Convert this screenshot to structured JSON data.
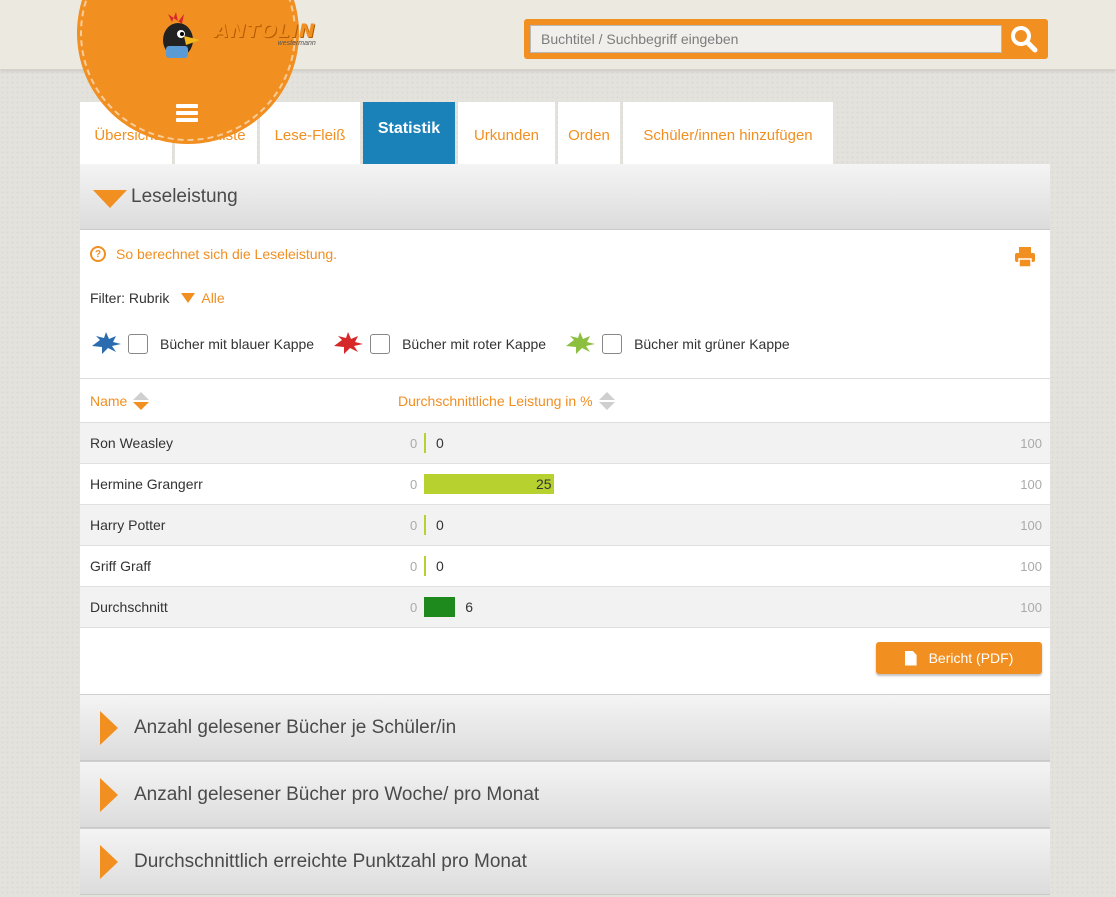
{
  "brand": {
    "name": "ANTOLIN",
    "sub": "westermann"
  },
  "search": {
    "placeholder": "Buchtitel / Suchbegriff eingeben"
  },
  "tabs": [
    {
      "label": "Übersicht",
      "active": false
    },
    {
      "label": "Leseliste",
      "active": false
    },
    {
      "label": "Lese-Fleiß",
      "active": false
    },
    {
      "label": "Statistik",
      "active": true
    },
    {
      "label": "Urkunden",
      "active": false
    },
    {
      "label": "Orden",
      "active": false
    },
    {
      "label": "Schüler/innen hinzufügen",
      "active": false
    }
  ],
  "lead": {
    "title": "Leseleistung",
    "help": "So berechnet sich die Leseleistung.",
    "filter_label": "Filter: Rubrik",
    "filter_value": "Alle",
    "caps": [
      {
        "label": "Bücher mit blauer Kappe",
        "color": "#2b6cb0",
        "icon": "blue-cap-icon"
      },
      {
        "label": "Bücher mit roter Kappe",
        "color": "#d62828",
        "icon": "red-cap-icon"
      },
      {
        "label": "Bücher mit grüner Kappe",
        "color": "#8cbf3f",
        "icon": "green-cap-icon"
      }
    ],
    "col_name": "Name",
    "col_perf": "Durchschnittliche Leistung in %",
    "min_label": "0",
    "max_label": "100",
    "rows": [
      {
        "name": "Ron Weasley",
        "value": 0,
        "label": "0",
        "color": "#b7d12f"
      },
      {
        "name": "Hermine Grangerr",
        "value": 25,
        "label": "25",
        "color": "#b7d12f"
      },
      {
        "name": "Harry Potter",
        "value": 0,
        "label": "0",
        "color": "#b7d12f"
      },
      {
        "name": "Griff Graff",
        "value": 0,
        "label": "0",
        "color": "#b7d12f"
      },
      {
        "name": "Durchschnitt",
        "value": 6,
        "label": "6",
        "color": "#1e8a1e"
      }
    ],
    "report_button": "Bericht (PDF)"
  },
  "accordions": [
    "Anzahl gelesener Bücher je Schüler/in",
    "Anzahl gelesener Bücher pro Woche/ pro Monat",
    "Durchschnittlich erreichte Punktzahl pro Monat"
  ],
  "colors": {
    "accent": "#f18f21",
    "active_tab": "#1a82b8"
  }
}
